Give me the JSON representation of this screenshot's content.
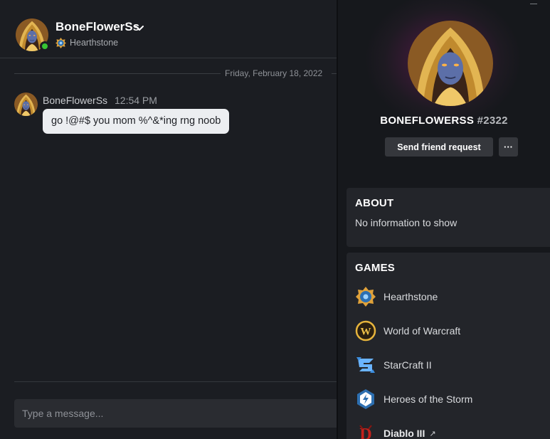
{
  "chat": {
    "header": {
      "username": "BoneFlowerSs",
      "status": "online",
      "game": "Hearthstone"
    },
    "date_divider": "Friday, February 18, 2022",
    "messages": [
      {
        "author": "BoneFlowerSs",
        "time": "12:54 PM",
        "text": "go !@#$ you mom %^&*ing rng noob"
      }
    ],
    "compose": {
      "placeholder": "Type a message..."
    }
  },
  "profile": {
    "display_name": "BONEFLOWERSS",
    "tag": "#2322",
    "friend_button": "Send friend request",
    "more_button": "···",
    "about": {
      "title": "ABOUT",
      "text": "No information to show"
    },
    "games": {
      "title": "GAMES",
      "items": [
        {
          "label": "Hearthstone",
          "icon": "hearthstone-icon"
        },
        {
          "label": "World of Warcraft",
          "icon": "wow-icon"
        },
        {
          "label": "StarCraft II",
          "icon": "starcraft-icon"
        },
        {
          "label": "Heroes of the Storm",
          "icon": "heroes-icon"
        },
        {
          "label": "Diablo III",
          "icon": "diablo-icon",
          "external": "↗"
        }
      ]
    }
  },
  "colors": {
    "online": "#37c533",
    "bubble": "#eceef1",
    "panel": "#23252a"
  }
}
